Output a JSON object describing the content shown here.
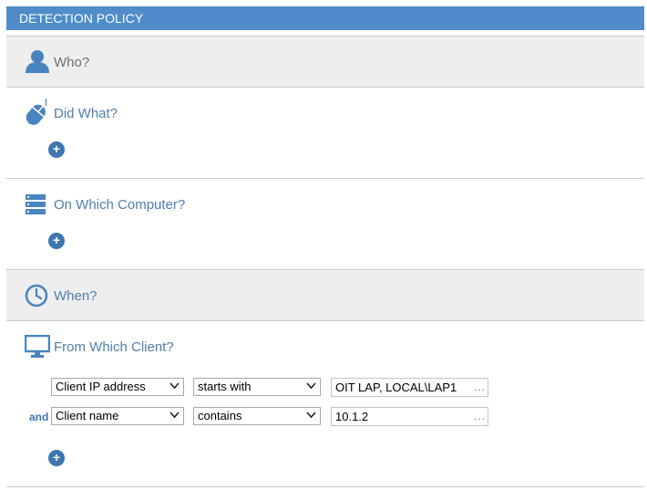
{
  "header": {
    "title": "DETECTION POLICY"
  },
  "sections": {
    "who": {
      "title": "Who?"
    },
    "did_what": {
      "title": "Did What?"
    },
    "computer": {
      "title": "On Which Computer?"
    },
    "when": {
      "title": "When?"
    },
    "client": {
      "title": "From Which Client?"
    }
  },
  "add_label": "+",
  "conditions": [
    {
      "connector": "",
      "field": "Client IP address",
      "operator": "starts with",
      "value": "OIT LAP, LOCAL\\LAP1",
      "browse": "..."
    },
    {
      "connector": "and",
      "field": "Client name",
      "operator": "contains",
      "value": "10.1.2",
      "browse": "..."
    }
  ],
  "colors": {
    "accent": "#4f8cc9",
    "link": "#4f7fae",
    "button": "#3d76b0"
  },
  "icons": [
    "user-icon",
    "mouse-icon",
    "server-icon",
    "clock-icon",
    "monitor-icon",
    "add-icon",
    "chevron-down-icon"
  ]
}
